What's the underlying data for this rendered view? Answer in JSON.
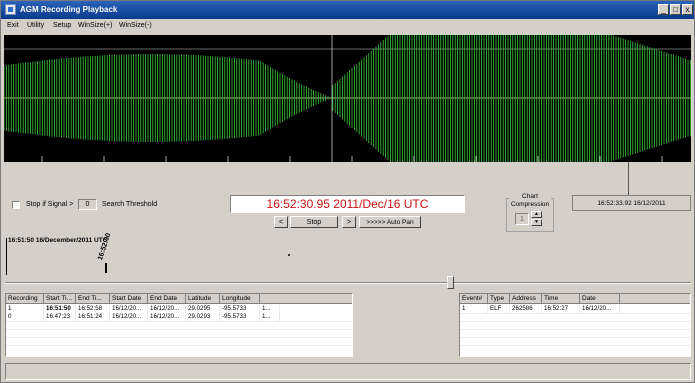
{
  "window": {
    "title": "AGM Recording Playback",
    "min_glyph": "_",
    "max_glyph": "□",
    "close_glyph": "x"
  },
  "menu": [
    "Exit",
    "Utility",
    "Setup",
    "WinSize(+)",
    "WinSize(-)"
  ],
  "controls": {
    "stop_signal_label": "Stop if Signal >",
    "threshold_value": "0",
    "threshold_label": "Search Threshold",
    "time_display": "16:52:30.95 2011/Dec/16 UTC",
    "prev_button": "<",
    "stop_button": "Stop",
    "next_button": ">",
    "auto_pan_button": ">>>>> Auto Pan",
    "chart_compression_title": "Chart Compression",
    "compression_value": "1",
    "cursor_time": "16:52:33.92 16/12/2011"
  },
  "timeline": {
    "start_label": "16:51:50  16/December/2011 UTC",
    "tick_label": "16:52:00"
  },
  "colors": {
    "time_red": "#cc1010",
    "wave_green": "#3ec93e",
    "title_blue": "#0a3a8c"
  },
  "recordings": {
    "columns": [
      "Recording",
      "Start Ti...",
      "End Ti...",
      "Start Date",
      "End Date",
      "Latitude",
      "Longitude",
      ""
    ],
    "rows": [
      [
        "1",
        "16:51:50",
        "16:52:58",
        "16/12/20...",
        "16/12/20...",
        "29.0295",
        "-95.5733",
        "1..."
      ],
      [
        "0",
        "16:47:23",
        "16:51:24",
        "16/12/20...",
        "16/12/20...",
        "29.0293",
        "-95.5733",
        "1..."
      ]
    ]
  },
  "events": {
    "columns": [
      "Event#",
      "Type",
      "Address",
      "Time",
      "Date"
    ],
    "rows": [
      [
        "1",
        "ELF",
        "262586",
        "16:52:27",
        "16/12/20..."
      ]
    ]
  }
}
